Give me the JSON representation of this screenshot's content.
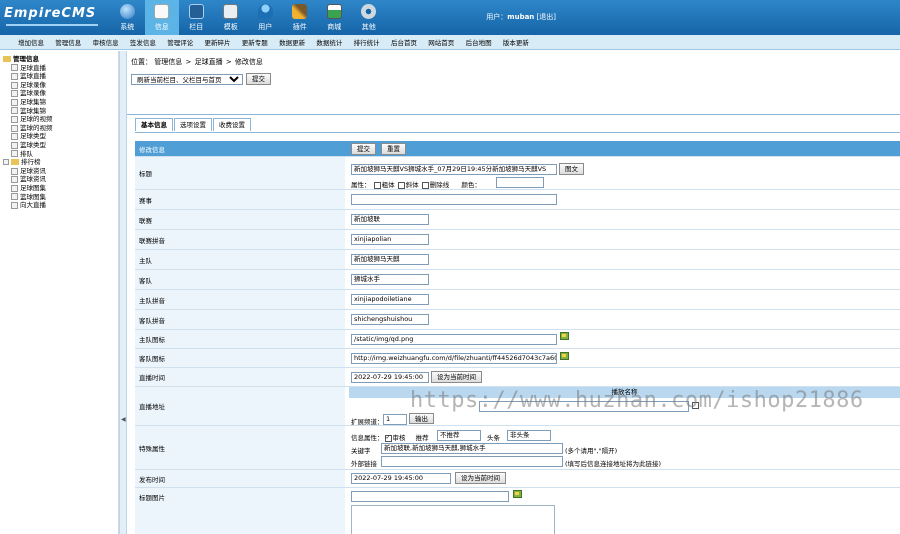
{
  "header": {
    "logo_text": "EmpireCMS",
    "nav": [
      {
        "label": "系统",
        "icon": "globe-icon",
        "color": "#3a8ad0"
      },
      {
        "label": "信息",
        "icon": "edit-doc-icon",
        "color": "#f5f5f5",
        "active": true
      },
      {
        "label": "栏目",
        "icon": "folder-icon",
        "color": "#2d74b6"
      },
      {
        "label": "模板",
        "icon": "template-icon",
        "color": "#3d86c6"
      },
      {
        "label": "用户",
        "icon": "user-icon",
        "color": "#2f8ad6"
      },
      {
        "label": "插件",
        "icon": "tools-icon",
        "color": "#f4b12f"
      },
      {
        "label": "商城",
        "icon": "shop-icon",
        "color": "#37a44d"
      },
      {
        "label": "其他",
        "icon": "gear-icon",
        "color": "#c9d6e0"
      }
    ],
    "user_label": "用户：",
    "username": "muban",
    "logout": "[退出]"
  },
  "subnav": [
    "增加信息",
    "管理信息",
    "审核信息",
    "签发信息",
    "管理评论",
    "更新碎片",
    "更新专题",
    "数据更新",
    "数据统计",
    "排行统计",
    "后台首页",
    "网站首页",
    "后台地图",
    "版本更新"
  ],
  "sidebar": {
    "root": "管理信息",
    "items": [
      "足球直播",
      "篮球直播",
      "足球录像",
      "篮球录像",
      "足球集锦",
      "篮球集锦",
      "足球的视频",
      "篮球的视频",
      "足球类型",
      "篮球类型",
      "排队"
    ],
    "group": "排行榜",
    "group_items": [
      "足球资讯",
      "篮球资讯",
      "足球图集",
      "篮球图集",
      "向大直播"
    ]
  },
  "main": {
    "crumb": {
      "prefix": "位置：",
      "a": "管理信息",
      "sep": ">",
      "b": "足球直播",
      "c": "修改信息"
    },
    "select": "刷新当前栏目、父栏目与首页",
    "submit": "提交",
    "tabs": [
      "基本信息",
      "选项设置",
      "收费设置"
    ],
    "form": {
      "header_label": "修改信息",
      "header_submit": "提交",
      "header_reset": "重置",
      "title_label": "标题",
      "title_value": "新加坡狮马天麒VS狮城水手_07月29日19:45分新加坡狮马天麒VS",
      "title_btn": "图文",
      "attr_label": "属性：",
      "bold": "粗体",
      "italic": "斜体",
      "strike": "删除线",
      "color_label": "颜色：",
      "league_label": "赛事",
      "league_value": "",
      "match_label": "联赛",
      "match_value": "新加坡联",
      "match_py_label": "联赛拼音",
      "match_py_value": "xinjiapolian",
      "home_label": "主队",
      "home_value": "新加坡狮马天麒",
      "away_label": "客队",
      "away_value": "狮城水手",
      "home_py_label": "主队拼音",
      "home_py_value": "xinjiapodoiletiane",
      "away_py_label": "客队拼音",
      "away_py_value": "shichengshuishou",
      "home_logo_label": "主队图标",
      "home_logo_value": "/static/img/qd.png",
      "away_logo_label": "客队图标",
      "away_logo_value": "http://img.weizhuangfu.com/d/file/zhuanti/ff44526d7043c7a606",
      "time_label": "直播时间",
      "time_value": "2022-07-29 19:45:00",
      "set_now": "设为当前时间",
      "addr_label": "直播地址",
      "addr_subhead": "播放名称",
      "ext_label": "扩展频道：",
      "ext_value": "1",
      "ext_btn": "输出",
      "special_label": "特殊属性",
      "info_attr": "信息属性：",
      "review": "审核",
      "recommend_label": "推荐",
      "recommend_value": "不推荐",
      "headline_label": "头条",
      "headline_value": "非头条",
      "keywords_label": "关键字",
      "keywords_value": "新加坡联,新加坡狮马天麒,狮城水手",
      "keywords_hint": "(多个请用\",\"隔开)",
      "link_label": "外部链接",
      "link_hint": "(填写后信息连接地址将为此链接)",
      "pub_label": "发布时间",
      "pub_value": "2022-07-29 19:45:00",
      "title_pic_label": "标题图片"
    }
  },
  "watermark": "https://www.huzhan.com/ishop21886"
}
